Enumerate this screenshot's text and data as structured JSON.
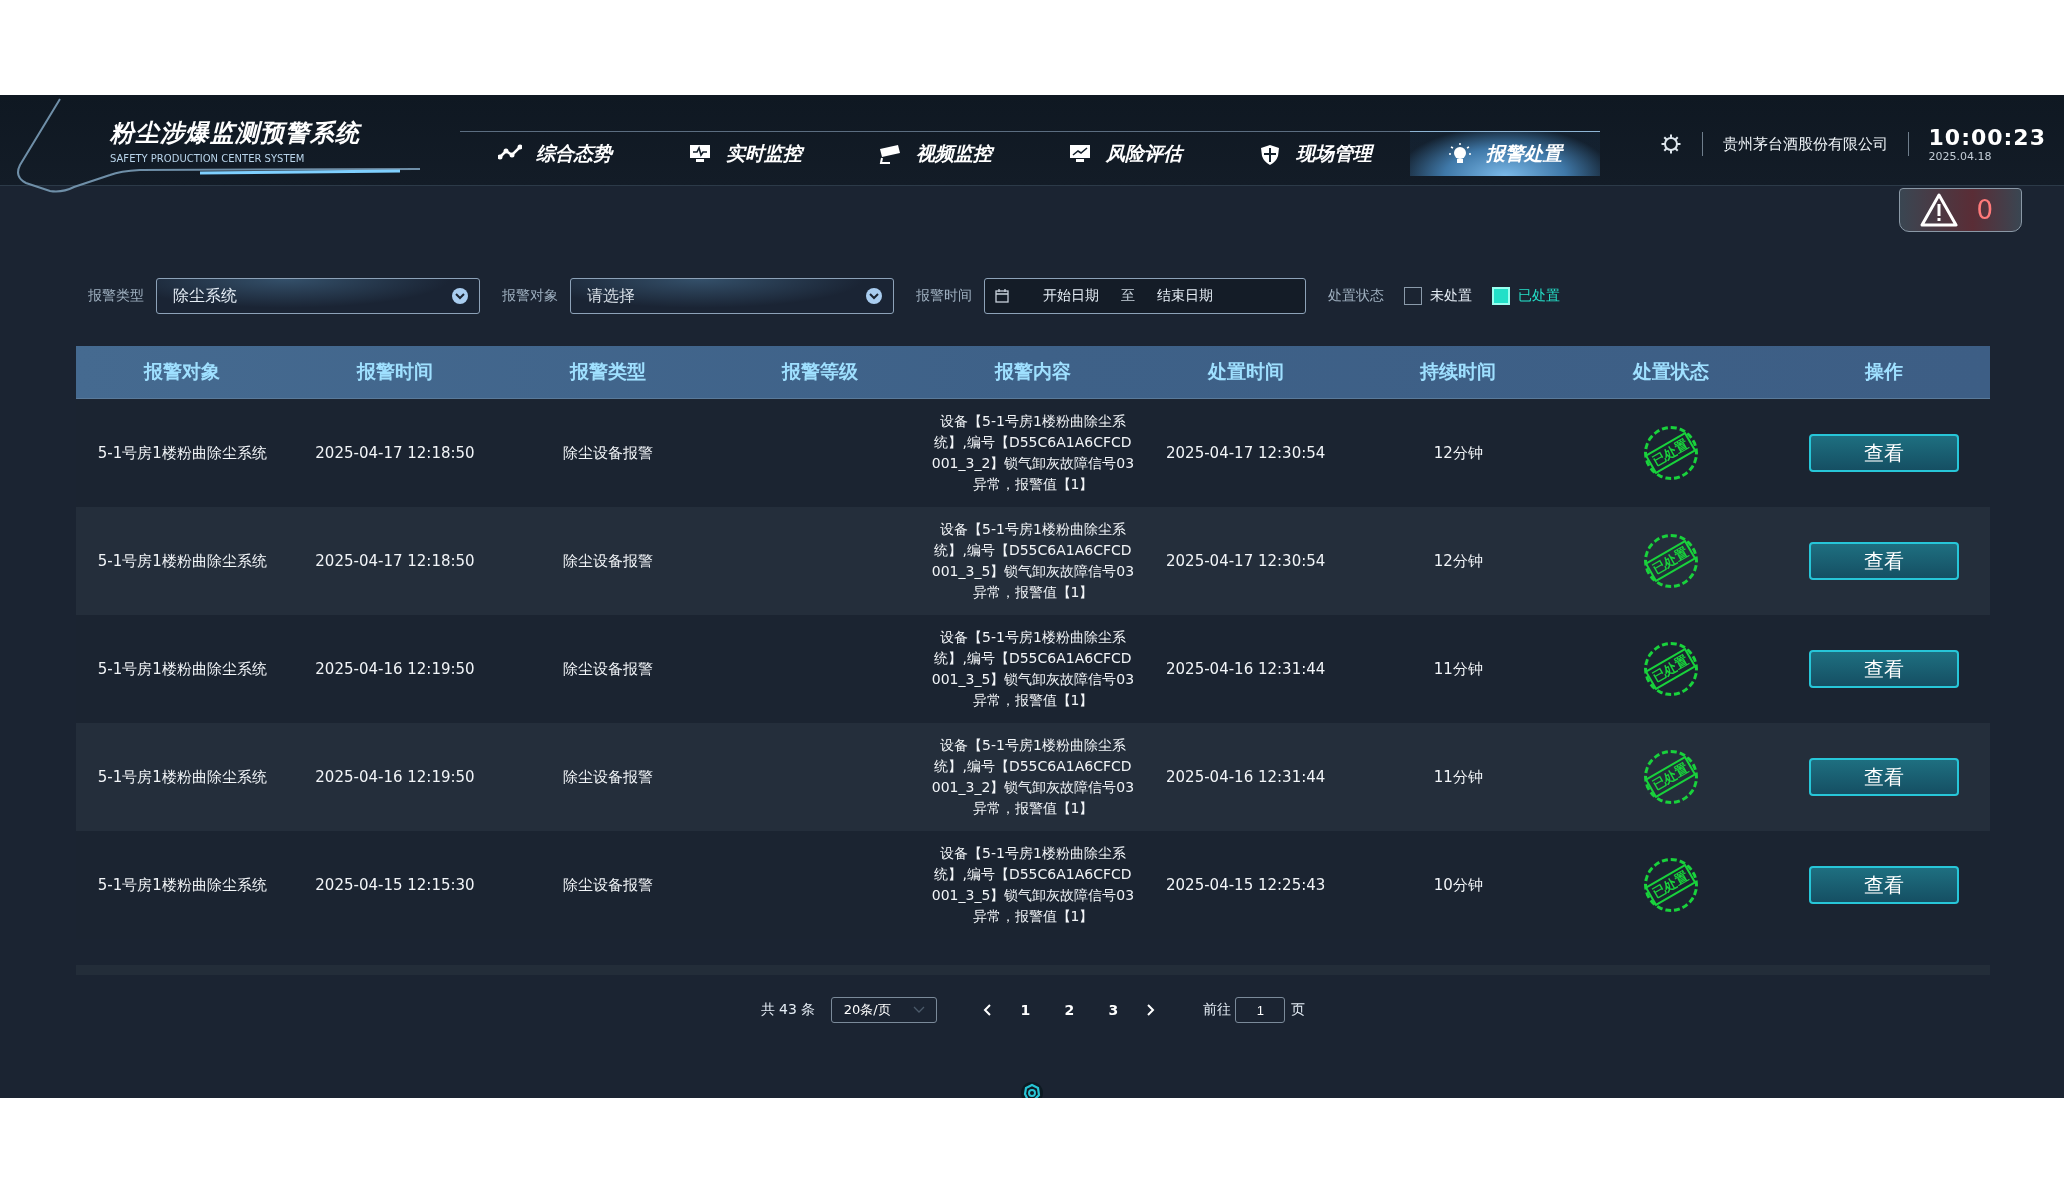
{
  "header": {
    "title": "粉尘涉爆监测预警系统",
    "subtitle": "SAFETY PRODUCTION CENTER SYSTEM",
    "company": "贵州茅台酒股份有限公司",
    "time": "10:00:23",
    "date": "2025.04.18",
    "alert_count": "0"
  },
  "nav": [
    {
      "label": "综合态势",
      "selected": false
    },
    {
      "label": "实时监控",
      "selected": false
    },
    {
      "label": "视频监控",
      "selected": false
    },
    {
      "label": "风险评估",
      "selected": false
    },
    {
      "label": "现场管理",
      "selected": false
    },
    {
      "label": "报警处置",
      "selected": true
    }
  ],
  "filters": [
    {
      "kind": "select",
      "label": "报警类型",
      "value": "除尘系统"
    },
    {
      "kind": "select",
      "label": "报警对象",
      "placeholder": "请选择"
    },
    {
      "kind": "daterange",
      "label": "报警时间",
      "start_placeholder": "开始日期",
      "separator": "至",
      "end_placeholder": "结束日期"
    },
    {
      "kind": "checkboxes",
      "label": "处置状态",
      "options": [
        {
          "label": "未处置",
          "checked": false
        },
        {
          "label": "已处置",
          "checked": true
        }
      ]
    }
  ],
  "table": {
    "columns": [
      "报警对象",
      "报警时间",
      "报警类型",
      "报警等级",
      "报警内容",
      "处置时间",
      "持续时间",
      "处置状态",
      "操作"
    ],
    "rows": [
      {
        "object": "5-1号房1楼粉曲除尘系统",
        "time": "2025-04-17 12:18:50",
        "type": "除尘设备报警",
        "content": "设备【5-1号房1楼粉曲除尘系统】,编号【D55C6A1A6CFCD001_3_2】锁气卸灰故障信号03异常，报警值【1】",
        "handled_time": "2025-04-17 12:30:54",
        "duration": "12分钟",
        "status": "已处置",
        "action": "查看"
      },
      {
        "object": "5-1号房1楼粉曲除尘系统",
        "time": "2025-04-17 12:18:50",
        "type": "除尘设备报警",
        "content": "设备【5-1号房1楼粉曲除尘系统】,编号【D55C6A1A6CFCD001_3_5】锁气卸灰故障信号03异常，报警值【1】",
        "handled_time": "2025-04-17 12:30:54",
        "duration": "12分钟",
        "status": "已处置",
        "action": "查看"
      },
      {
        "object": "5-1号房1楼粉曲除尘系统",
        "time": "2025-04-16 12:19:50",
        "type": "除尘设备报警",
        "content": "设备【5-1号房1楼粉曲除尘系统】,编号【D55C6A1A6CFCD001_3_5】锁气卸灰故障信号03异常，报警值【1】",
        "handled_time": "2025-04-16 12:31:44",
        "duration": "11分钟",
        "status": "已处置",
        "action": "查看"
      },
      {
        "object": "5-1号房1楼粉曲除尘系统",
        "time": "2025-04-16 12:19:50",
        "type": "除尘设备报警",
        "content": "设备【5-1号房1楼粉曲除尘系统】,编号【D55C6A1A6CFCD001_3_2】锁气卸灰故障信号03异常，报警值【1】",
        "handled_time": "2025-04-16 12:31:44",
        "duration": "11分钟",
        "status": "已处置",
        "action": "查看"
      },
      {
        "object": "5-1号房1楼粉曲除尘系统",
        "time": "2025-04-15 12:15:30",
        "type": "除尘设备报警",
        "content": "设备【5-1号房1楼粉曲除尘系统】,编号【D55C6A1A6CFCD001_3_5】锁气卸灰故障信号03异常，报警值【1】",
        "handled_time": "2025-04-15 12:25:43",
        "duration": "10分钟",
        "status": "已处置",
        "action": "查看"
      }
    ]
  },
  "pagination": {
    "total": "共 43 条",
    "page_size": "20条/页",
    "pages": [
      "1",
      "2",
      "3"
    ],
    "goto_prefix": "前往",
    "goto_value": "1",
    "goto_suffix": "页"
  }
}
